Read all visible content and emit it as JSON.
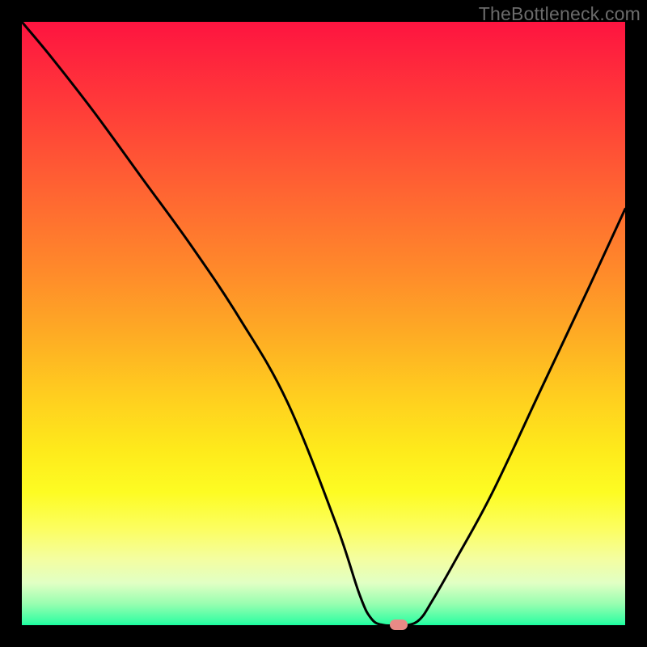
{
  "watermark": "TheBottleneck.com",
  "chart_data": {
    "type": "line",
    "title": "",
    "xlabel": "",
    "ylabel": "",
    "xlim": [
      0,
      100
    ],
    "ylim": [
      0,
      100
    ],
    "background_gradient": {
      "top_color": "#fe1440",
      "bottom_color": "#17fd9f",
      "description": "red at top through orange, yellow to green at bottom; vertical axis maps bottleneck severity (green=optimal)"
    },
    "series": [
      {
        "name": "bottleneck-curve",
        "x": [
          0,
          5,
          12,
          20,
          28,
          36,
          44,
          52,
          56,
          58,
          60,
          62,
          64,
          66,
          68,
          72,
          78,
          86,
          94,
          100
        ],
        "y": [
          100,
          94,
          85,
          74,
          63,
          51,
          37,
          17,
          5,
          1,
          0,
          0,
          0,
          1,
          4,
          11,
          22,
          39,
          56,
          69
        ]
      }
    ],
    "annotations": [
      {
        "name": "optimal-marker",
        "shape": "pill",
        "color": "#e88a86",
        "x": 62.5,
        "y": 0
      }
    ]
  }
}
